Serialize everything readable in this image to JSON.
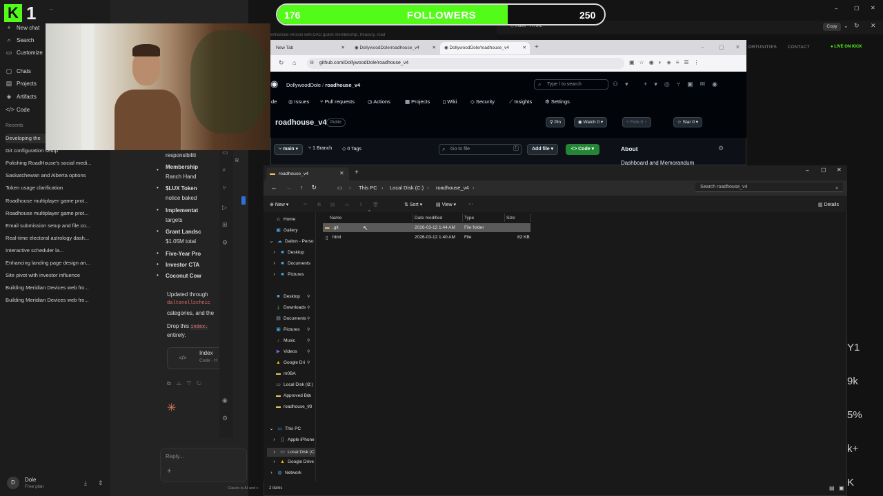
{
  "stream": {
    "followers_label": "FOLLOWERS",
    "followers_current": "176",
    "followers_goal": "250",
    "followers_fraction": 0.704,
    "accent": "#53fc18",
    "logo_letter": "K",
    "logo_number": "1"
  },
  "claude": {
    "nav": [
      "New chat",
      "Search",
      "Customize",
      "Chats",
      "Projects",
      "Artifacts",
      "Code"
    ],
    "recents_label": "Recents",
    "recents": [
      "Developing the",
      "Git configuration setup",
      "Polishing RoadHouse's social medi...",
      "Saskatchewan and Alberta options",
      "Token usage clarification",
      "Roadhouse multiplayer game prot...",
      "Roadhouse multiplayer game prot...",
      "Email submission setup and file co...",
      "Real-time electoral astrology dash...",
      "Interactive scheduler la...",
      "Enhancing landing page design an...",
      "Site pivot with investor influence",
      "Building Meridian Devices web fro...",
      "Building Meridian Devices web fro..."
    ],
    "user_initial": "D",
    "user_name": "Dole",
    "user_plan": "Free plan",
    "chat_lines": [
      "responsibiliti",
      "Membership",
      "Ranch Hand",
      "$LUX Token",
      "notice baked",
      "Implementat",
      "targets",
      "Grant Landsc",
      "$1.05M total",
      "Five-Year Pro",
      "Investor CTA",
      "Coconut Cow"
    ],
    "updated_line": "Updated through",
    "code_name": "daltonellscheic",
    "categories_line": "categories, and the",
    "drop_line_a": "Drop this",
    "drop_code": "index.",
    "drop_line_b": "entirely.",
    "chip_title": "Index",
    "chip_sub": "Code · H",
    "reply_placeholder": "Reply...",
    "footer": "Claude is AI and c"
  },
  "behind": {
    "copy_label": "Copy",
    "nav1": "ORTUNITIES",
    "nav2": "CONTACT",
    "live": "LIVE ON KICK",
    "numbers": [
      "Y1",
      "9k",
      "5%",
      "k+",
      "K"
    ],
    "top_tab": "index",
    "top_tab_type": "HTML",
    "faint_text": "enhanced version with DAO guilds membership, treasury, road"
  },
  "chrome": {
    "tabs": [
      "New Tab",
      "DollywoodDole/roadhouse_v4",
      "DollywoodDole/roadhouse_v4"
    ],
    "url": "github.com/DollywoodDole/roadhouse_v4"
  },
  "github": {
    "owner": "DollywoodDole",
    "repo_crumb": "roadhouse_v4",
    "search_placeholder": "Type / to search",
    "tabs": [
      "de",
      "Issues",
      "Pull requests",
      "Actions",
      "Projects",
      "Wiki",
      "Security",
      "Insights",
      "Settings"
    ],
    "repo_name": "roadhouse_v4",
    "visibility": "Public",
    "pin": "Pin",
    "watch": "Watch",
    "watch_count": "0",
    "fork": "Fork",
    "fork_count": "0",
    "star": "Star",
    "star_count": "0",
    "branch": "main",
    "branches": "1 Branch",
    "tags": "0 Tags",
    "goto_placeholder": "Go to file",
    "goto_key": "t",
    "add_file": "Add file",
    "code_btn": "Code",
    "about": "About",
    "description": "Dashboard and Memorandum"
  },
  "explorer": {
    "tab_title": "roadhouse_v4",
    "breadcrumb": [
      "This PC",
      "Local Disk (C:)",
      "roadhouse_v4"
    ],
    "search_placeholder": "Search roadhouse_v4",
    "commands": {
      "new": "New",
      "sort": "Sort",
      "view": "View",
      "details": "Details"
    },
    "nav_top": [
      "Home",
      "Gallery",
      "Dalton - Perso"
    ],
    "nav_dalton": [
      "Desktop",
      "Documents",
      "Pictures"
    ],
    "nav_quick": [
      "Desktop",
      "Downloads",
      "Documents",
      "Pictures",
      "Music",
      "Videos",
      "Google Dri",
      "m0BA",
      "Local Disk (C:)",
      "Approved Bra",
      "roadhouse_v3"
    ],
    "nav_pc_label": "This PC",
    "nav_pc": [
      "Apple iPhone",
      "Local Disk (C:",
      "Google Drive"
    ],
    "nav_network": "Network",
    "columns": [
      "Name",
      "Date modified",
      "Type",
      "Size"
    ],
    "files": [
      {
        "name": ".git",
        "date": "2026-03-12 1:44 AM",
        "type": "File folder",
        "size": ""
      },
      {
        "name": "html",
        "date": "2026-03-12 1:40 AM",
        "type": "File",
        "size": "82 KB"
      }
    ],
    "status": "2 items"
  }
}
